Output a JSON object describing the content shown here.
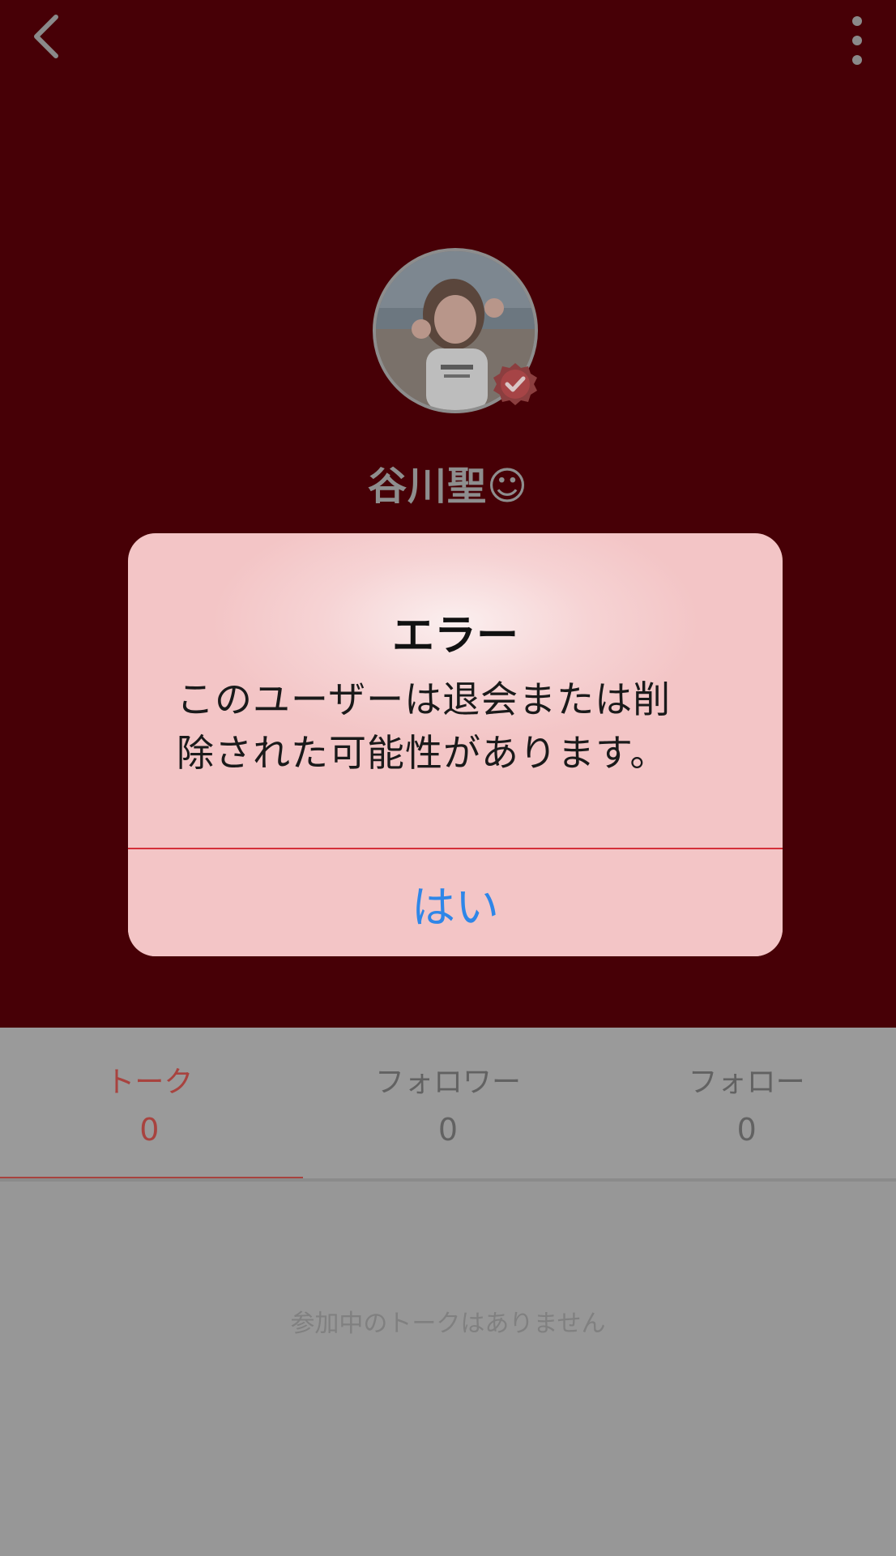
{
  "header": {
    "background": "#470006",
    "back_icon": "chevron-left-icon",
    "more_icon": "more-vertical-icon"
  },
  "profile": {
    "name": "谷川聖☺",
    "verified_icon": "verified-check-icon"
  },
  "tabs": [
    {
      "label": "トーク",
      "count": "0",
      "active": true
    },
    {
      "label": "フォロワー",
      "count": "0",
      "active": false
    },
    {
      "label": "フォロー",
      "count": "0",
      "active": false
    }
  ],
  "content": {
    "empty_message": "参加中のトークはありません"
  },
  "alert": {
    "title": "エラー",
    "message_line1": "このユーザーは退会または削",
    "message_line2": "除された可能性があります。",
    "button_label": "はい"
  },
  "colors": {
    "accent": "#a8433f",
    "alert_button_text": "#2e86e8",
    "alert_divider": "#d4303a"
  }
}
